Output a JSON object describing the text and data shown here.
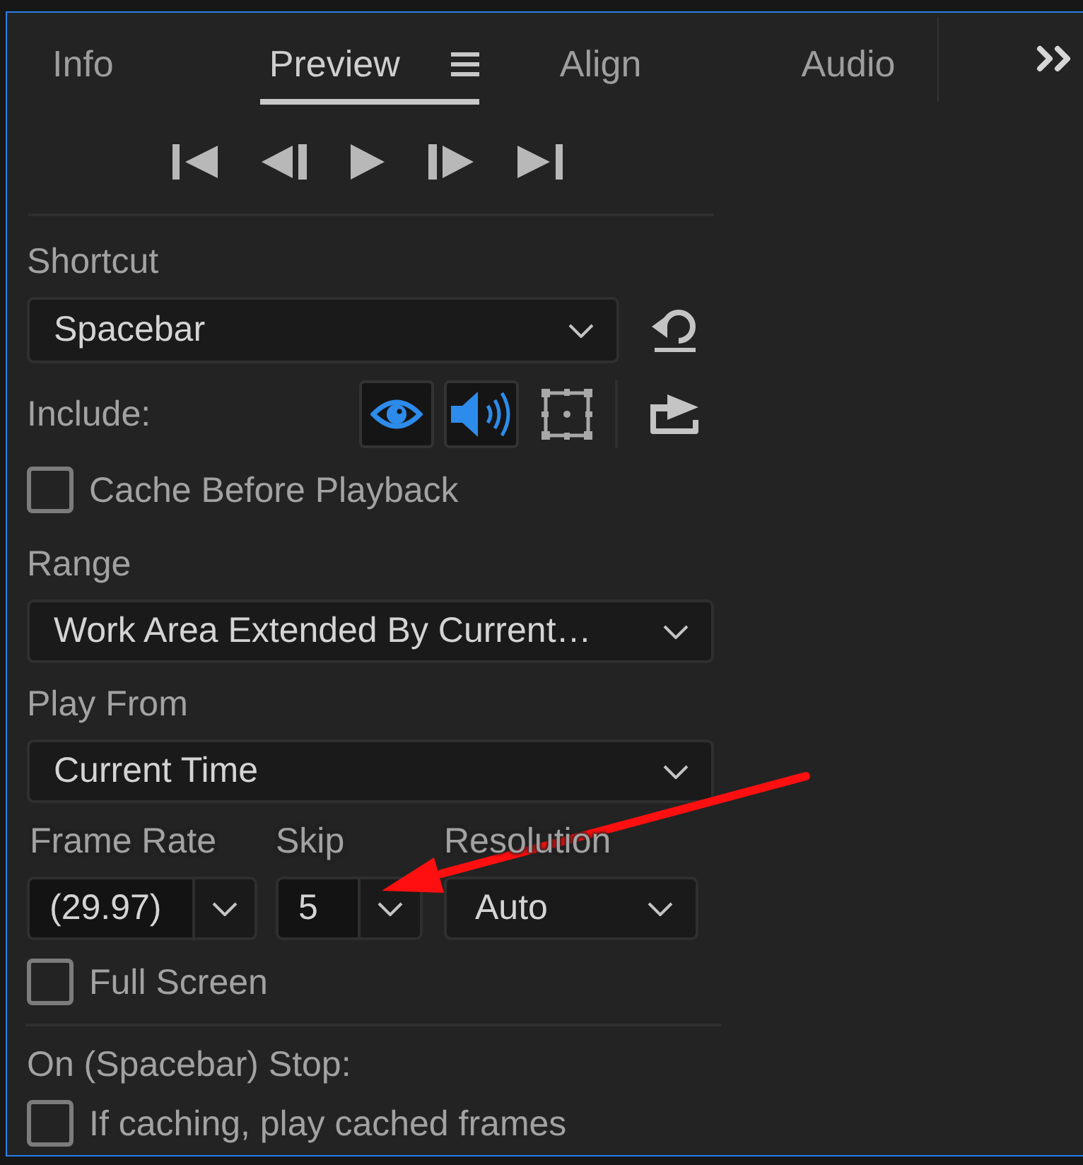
{
  "tabs": [
    {
      "label": "Info",
      "selected": false
    },
    {
      "label": "Preview",
      "selected": true
    },
    {
      "label": "Align",
      "selected": false
    },
    {
      "label": "Audio",
      "selected": false
    }
  ],
  "shortcut": {
    "label": "Shortcut",
    "value": "Spacebar"
  },
  "include": {
    "label": "Include:",
    "toggles": [
      {
        "kind": "video",
        "on": true
      },
      {
        "kind": "audio",
        "on": true
      },
      {
        "kind": "overlays",
        "on": false
      }
    ]
  },
  "cache_before_playback": {
    "label": "Cache Before Playback",
    "checked": false
  },
  "range": {
    "label": "Range",
    "value": "Work Area Extended By Current…"
  },
  "play_from": {
    "label": "Play From",
    "value": "Current Time"
  },
  "playback_settings": [
    {
      "kind": "split",
      "label": "Frame Rate",
      "value": "(29.97)"
    },
    {
      "kind": "split",
      "label": "Skip",
      "value": "5"
    },
    {
      "kind": "dropdown",
      "label": "Resolution",
      "value": "Auto"
    }
  ],
  "full_screen": {
    "label": "Full Screen",
    "checked": false
  },
  "on_stop": {
    "label": "On (Spacebar) Stop:",
    "options": [
      {
        "label": "If caching, play cached frames",
        "checked": false
      }
    ]
  }
}
